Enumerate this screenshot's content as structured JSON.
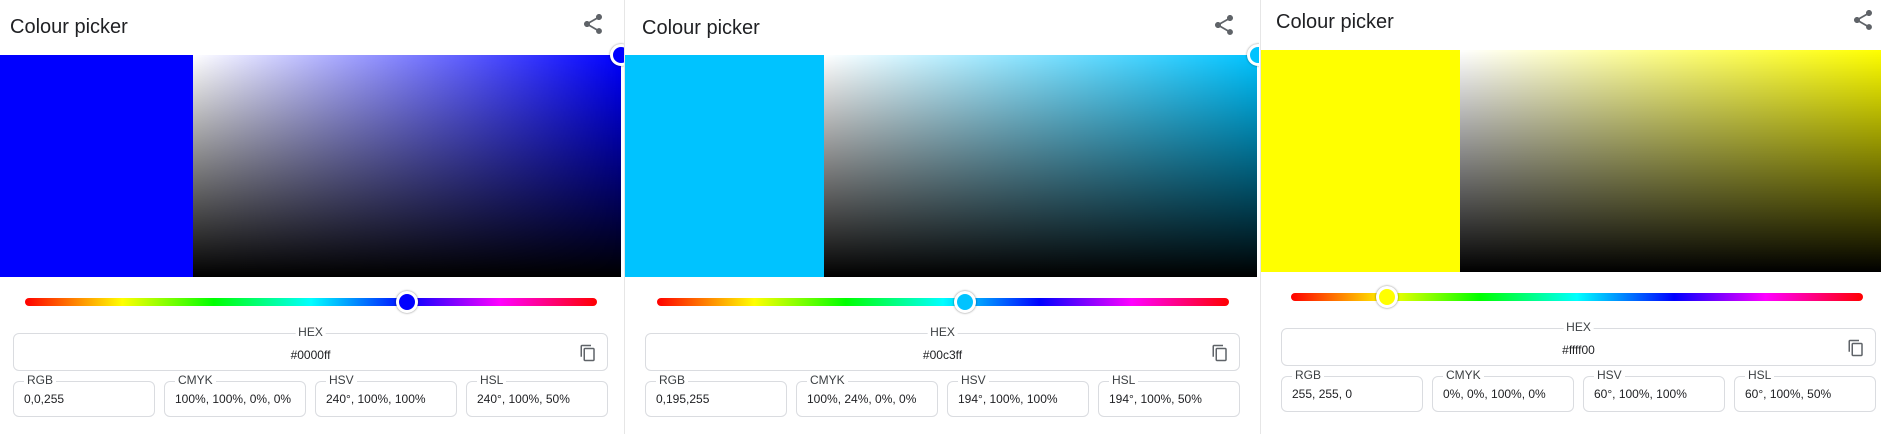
{
  "panels": [
    {
      "title": "Colour picker",
      "swatch_color": "#0000ff",
      "hue_color": "#0000ff",
      "hue_fraction": 0.667,
      "hex": {
        "label": "HEX",
        "value": "#0000ff"
      },
      "rgb": {
        "label": "RGB",
        "value": "0,0,255"
      },
      "cmyk": {
        "label": "CMYK",
        "value": "100%, 100%, 0%, 0%"
      },
      "hsv": {
        "label": "HSV",
        "value": "240°, 100%, 100%"
      },
      "hsl": {
        "label": "HSL",
        "value": "240°, 100%, 50%"
      },
      "share_icon": "share-icon",
      "copy_icon": "copy-icon"
    },
    {
      "title": "Colour picker",
      "swatch_color": "#00c3ff",
      "hue_color": "#00c3ff",
      "hue_fraction": 0.539,
      "hex": {
        "label": "HEX",
        "value": "#00c3ff"
      },
      "rgb": {
        "label": "RGB",
        "value": "0,195,255"
      },
      "cmyk": {
        "label": "CMYK",
        "value": "100%, 24%, 0%, 0%"
      },
      "hsv": {
        "label": "HSV",
        "value": "194°, 100%, 100%"
      },
      "hsl": {
        "label": "HSL",
        "value": "194°, 100%, 50%"
      },
      "share_icon": "share-icon",
      "copy_icon": "copy-icon"
    },
    {
      "title": "Colour picker",
      "swatch_color": "#ffff00",
      "hue_color": "#ffff00",
      "hue_fraction": 0.167,
      "hex": {
        "label": "HEX",
        "value": "#ffff00"
      },
      "rgb": {
        "label": "RGB",
        "value": "255, 255, 0"
      },
      "cmyk": {
        "label": "CMYK",
        "value": "0%, 0%, 100%, 0%"
      },
      "hsv": {
        "label": "HSV",
        "value": "60°, 100%, 100%"
      },
      "hsl": {
        "label": "HSL",
        "value": "60°, 100%, 50%"
      },
      "share_icon": "share-icon",
      "copy_icon": "copy-icon"
    }
  ],
  "colors": {
    "divider": "#e6e6e6",
    "field_border": "#dadce0"
  }
}
